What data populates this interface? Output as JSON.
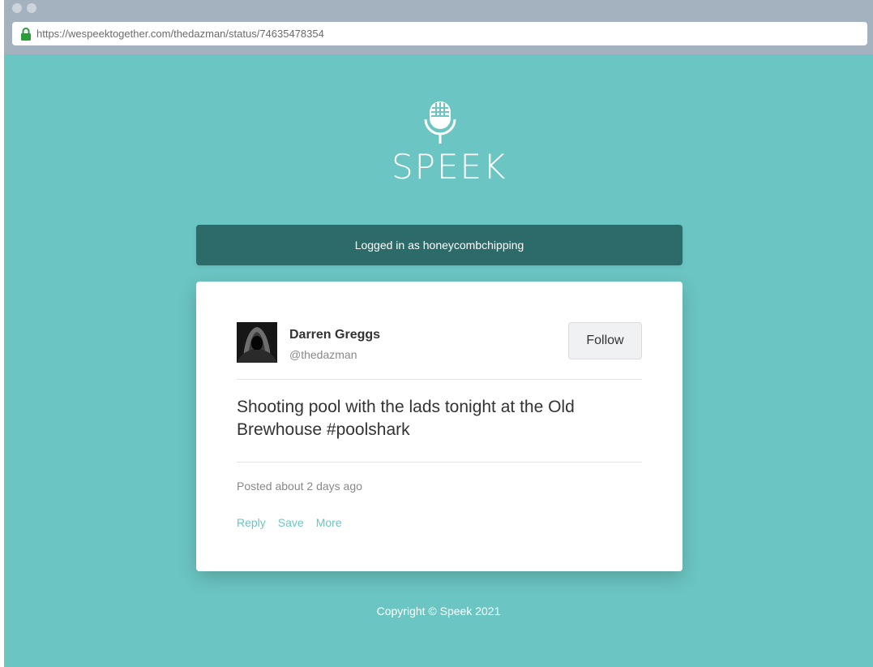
{
  "browser": {
    "url": "https://wespeektogether.com/thedazman/status/74635478354"
  },
  "brand": {
    "name": "SPEEK",
    "logo_icon": "microphone-icon",
    "colors": {
      "background": "#6bc5c2",
      "login_bar": "#2c6b69",
      "link": "#6bc5c2"
    }
  },
  "login": {
    "text": "Logged in as honeycombchipping"
  },
  "post": {
    "author_name": "Darren Greggs",
    "author_handle": "@thedazman",
    "follow_label": "Follow",
    "text": "Shooting pool with the lads tonight at the Old Brewhouse #poolshark",
    "posted": "Posted about 2 days ago",
    "actions": [
      "Reply",
      "Save",
      "More"
    ]
  },
  "footer": {
    "copyright": "Copyright © Speek 2021"
  }
}
